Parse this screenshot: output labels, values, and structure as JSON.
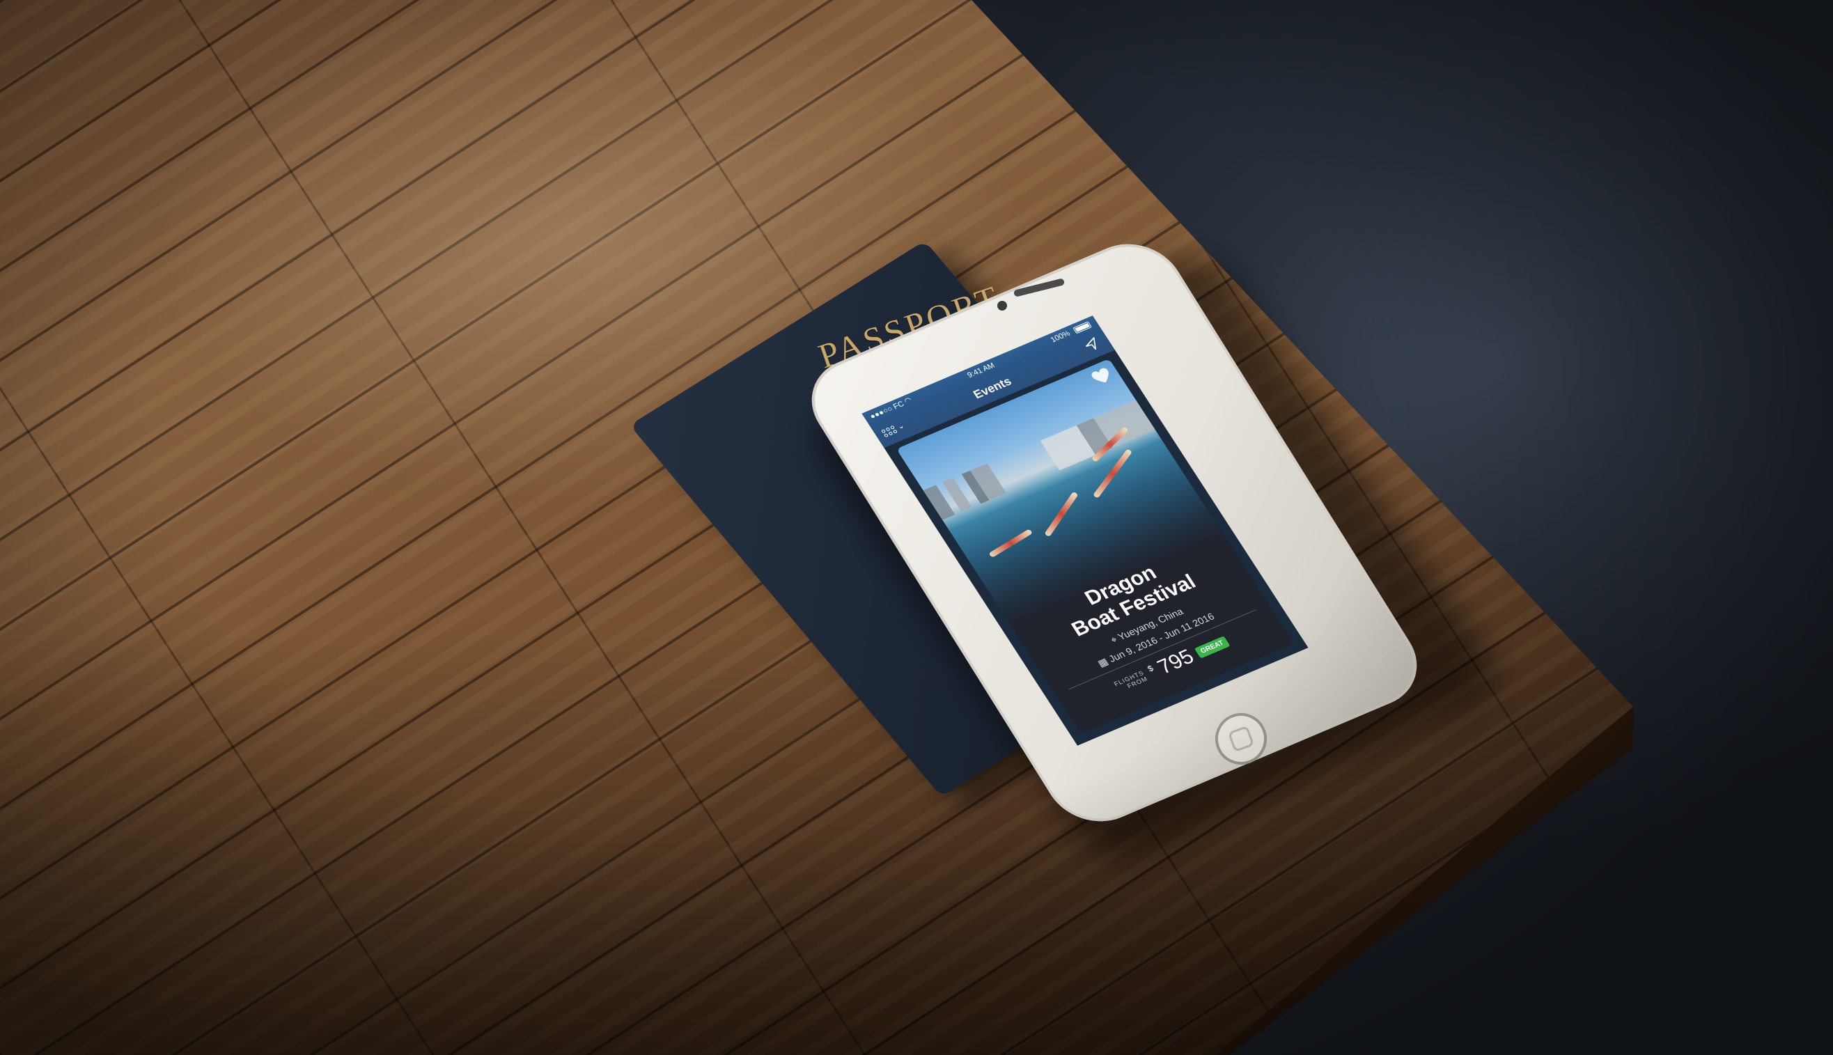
{
  "passport": {
    "cover_text": "PASSPORT"
  },
  "phone": {
    "status_bar": {
      "carrier": "●●●○○ FC",
      "wifi": "wifi-icon",
      "time": "9:41 AM",
      "battery": "100%"
    },
    "nav": {
      "title": "Events",
      "menu": "grid-menu-icon",
      "location": "location-arrow-icon"
    },
    "event": {
      "title_line1": "Dragon",
      "title_line2": "Boat Festival",
      "location": "Yueyang, China",
      "dates": "Jun 9, 2016 - Jun 11 2016",
      "flights_from_line1": "FLIGHTS",
      "flights_from_line2": "FROM",
      "currency": "$",
      "price": "795",
      "deal_badge": "GREAT"
    },
    "colors": {
      "nav": "#2a5586",
      "badge": "#3bb54a"
    }
  }
}
